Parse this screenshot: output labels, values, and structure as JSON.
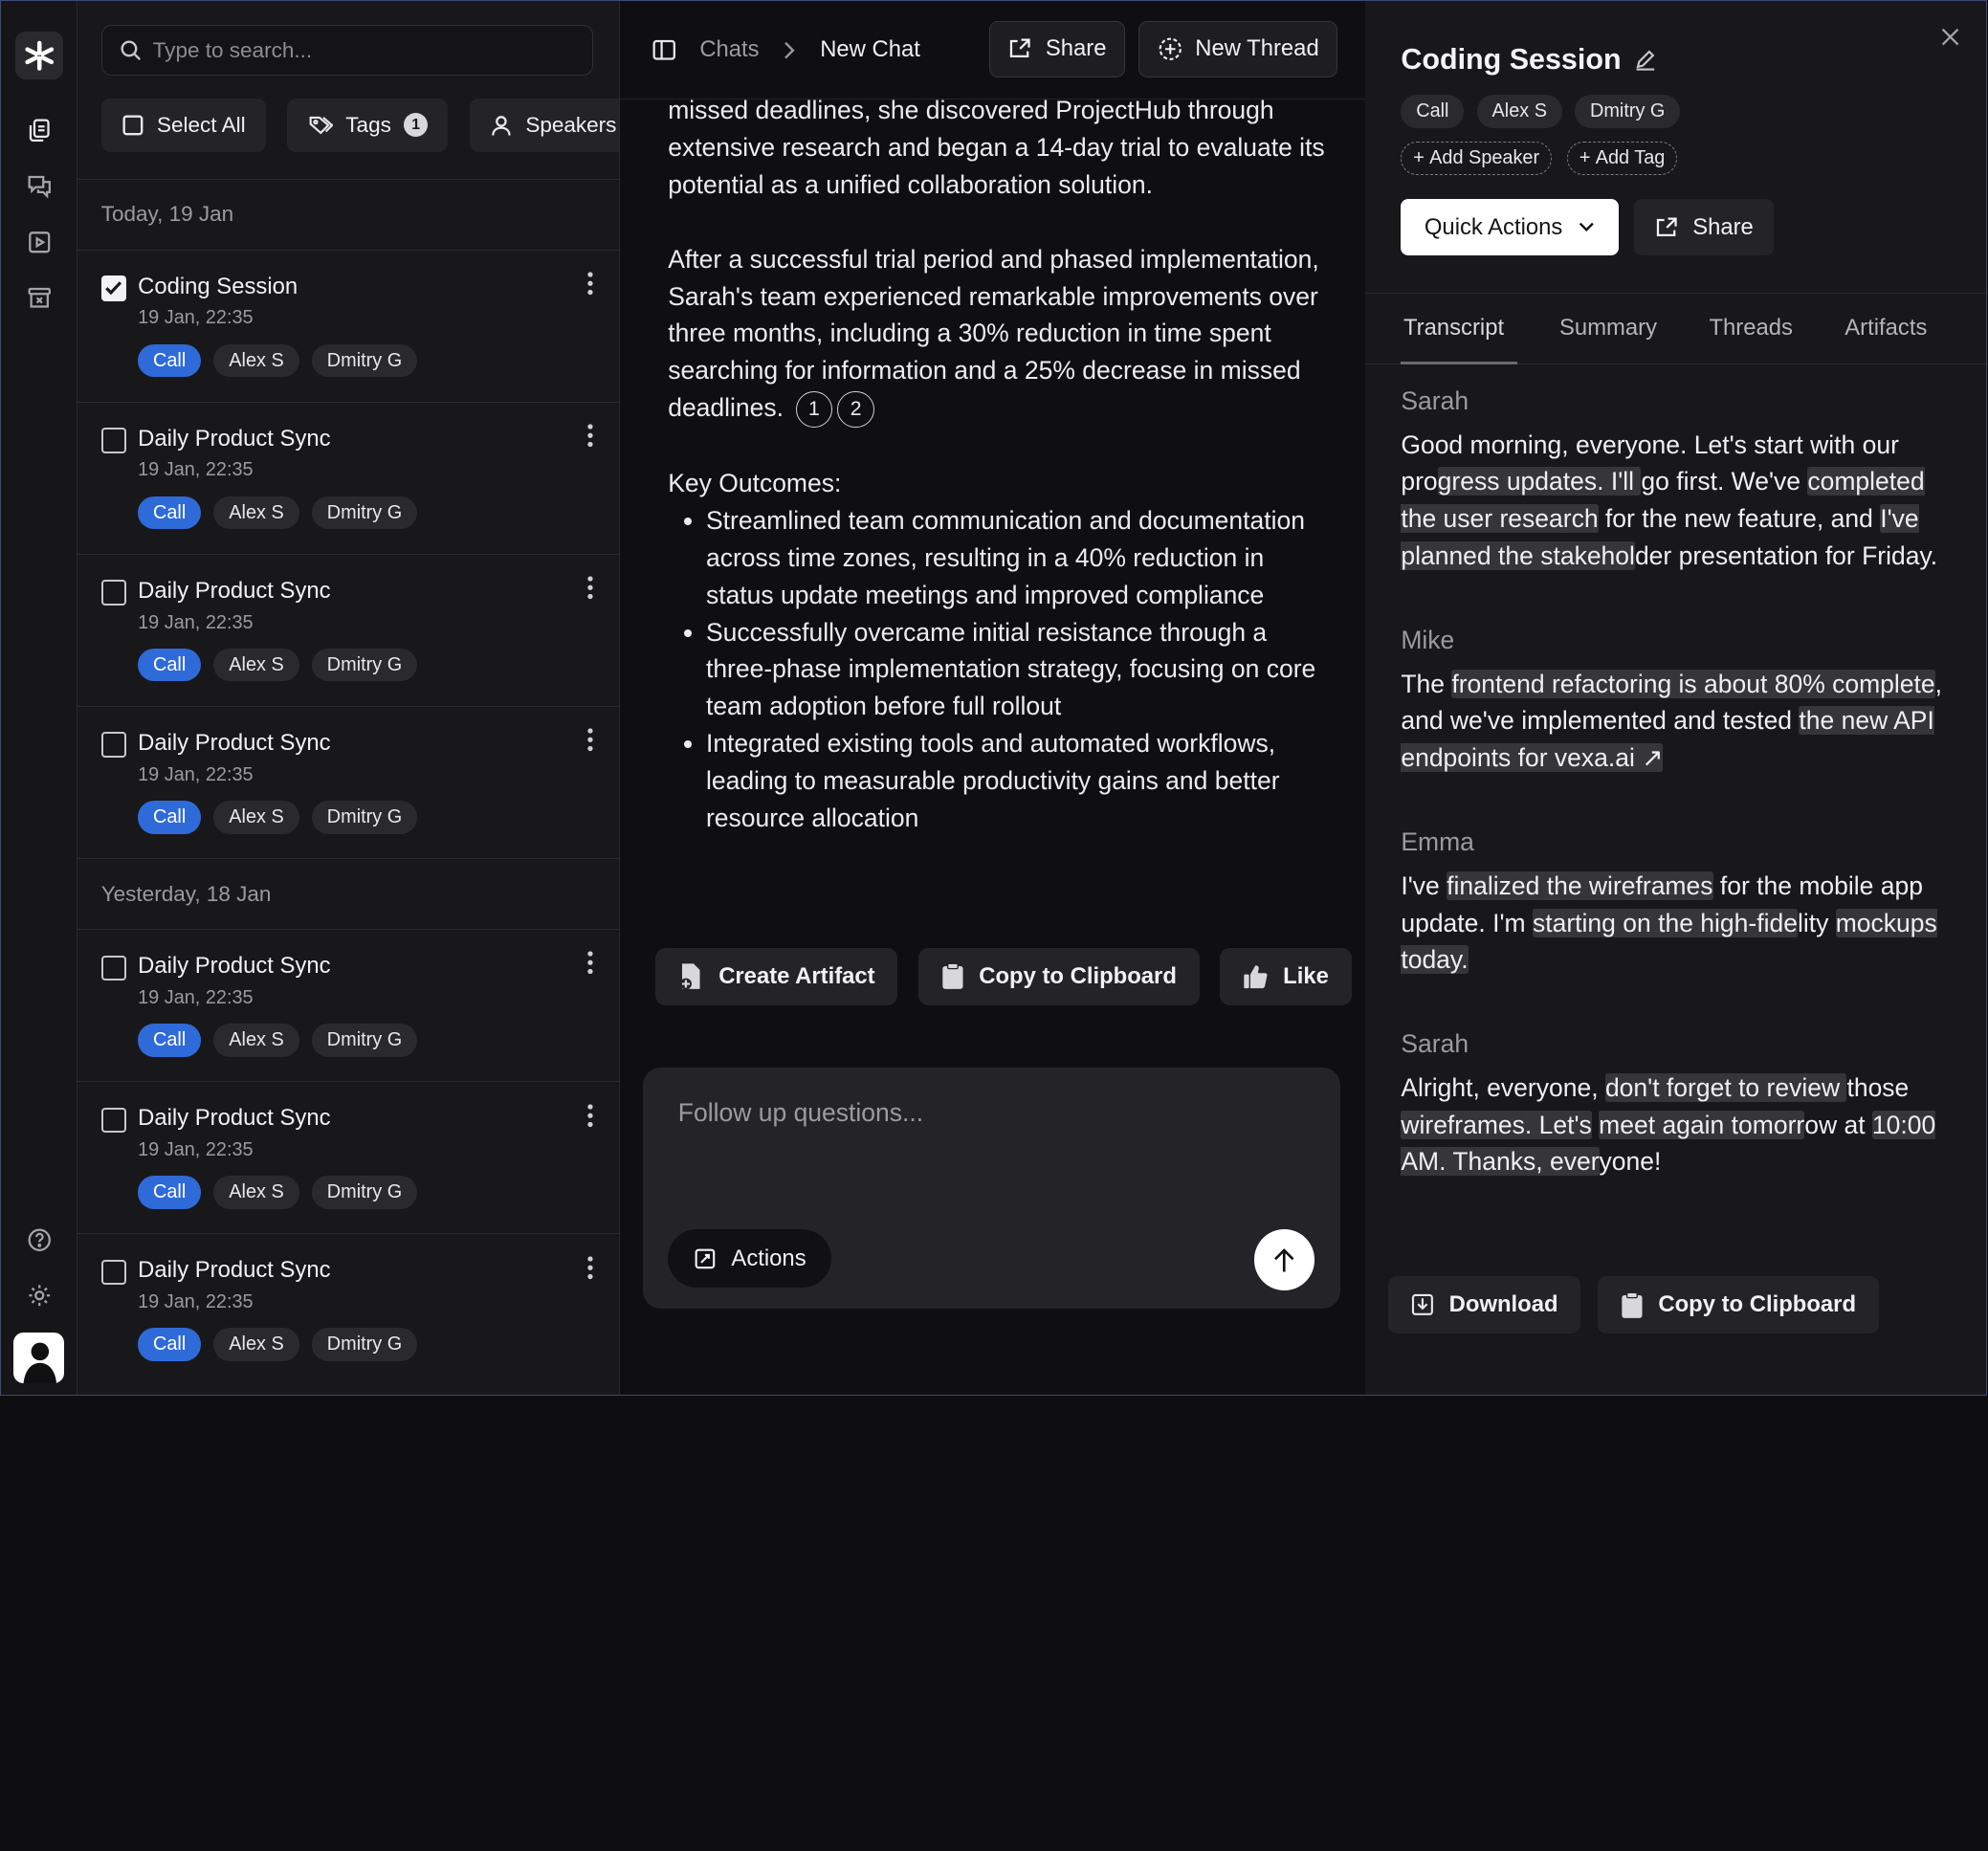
{
  "search": {
    "placeholder": "Type to search..."
  },
  "toolbar": {
    "select_all": "Select All",
    "tags": "Tags",
    "tags_count": "1",
    "speakers": "Speakers"
  },
  "groups": [
    {
      "label": "Today, 19 Jan"
    },
    {
      "label": "Yesterday, 18 Jan"
    }
  ],
  "items": [
    {
      "title": "Coding Session",
      "date": "19 Jan, 22:35",
      "checked": true,
      "tags": [
        "Call",
        "Alex S",
        "Dmitry G"
      ]
    },
    {
      "title": "Daily Product Sync",
      "date": "19 Jan, 22:35",
      "checked": false,
      "tags": [
        "Call",
        "Alex S",
        "Dmitry G"
      ]
    },
    {
      "title": "Daily Product Sync",
      "date": "19 Jan, 22:35",
      "checked": false,
      "tags": [
        "Call",
        "Alex S",
        "Dmitry G"
      ]
    },
    {
      "title": "Daily Product Sync",
      "date": "19 Jan, 22:35",
      "checked": false,
      "tags": [
        "Call",
        "Alex S",
        "Dmitry G"
      ]
    },
    {
      "title": "Daily Product Sync",
      "date": "19 Jan, 22:35",
      "checked": false,
      "tags": [
        "Call",
        "Alex S",
        "Dmitry G"
      ]
    },
    {
      "title": "Daily Product Sync",
      "date": "19 Jan, 22:35",
      "checked": false,
      "tags": [
        "Call",
        "Alex S",
        "Dmitry G"
      ]
    },
    {
      "title": "Daily Product Sync",
      "date": "19 Jan, 22:35",
      "checked": false,
      "tags": [
        "Call",
        "Alex S",
        "Dmitry G"
      ]
    }
  ],
  "chat": {
    "breadcrumb": [
      "Chats",
      "New Chat"
    ],
    "share": "Share",
    "new_thread": "New Thread",
    "p1": "missed deadlines, she discovered ProjectHub through extensive research and began a 14-day trial to evaluate its potential as a unified collaboration solution.",
    "p2": "After a successful trial period and phased implementation, Sarah's team experienced remarkable improvements over three months, including a 30% reduction in time spent searching for information and a 25% decrease in missed deadlines.",
    "citations": [
      "1",
      "2"
    ],
    "outcomes_title": "Key Outcomes:",
    "outcomes": [
      "Streamlined team communication and documentation across time zones, resulting in a 40% reduction in status update meetings and improved compliance",
      "Successfully overcame initial resistance through a three-phase implementation strategy, focusing on core team adoption before full rollout",
      "Integrated existing tools and automated workflows, leading to measurable productivity gains and better resource allocation"
    ],
    "actions": {
      "create": "Create Artifact",
      "copy": "Copy to Clipboard",
      "like": "Like"
    },
    "composer_placeholder": "Follow up questions...",
    "actions_btn": "Actions"
  },
  "panel": {
    "title": "Coding Session",
    "tags": [
      "Call",
      "Alex S",
      "Dmitry G"
    ],
    "add_speaker": "Add Speaker",
    "add_tag": "Add Tag",
    "quick_actions": "Quick Actions",
    "share": "Share",
    "tabs": [
      "Transcript",
      "Summary",
      "Threads",
      "Artifacts"
    ],
    "download": "Download",
    "copy": "Copy to Clipboard"
  },
  "transcript": [
    {
      "speaker": "Sarah",
      "segments": [
        {
          "t": "Good morning, everyone. Let's start with our pro"
        },
        {
          "t": "gress updates. I'll ",
          "h": true
        },
        {
          "t": "go first. We've "
        },
        {
          "t": "completed the user research",
          "h": true
        },
        {
          "t": " for the new feature, and "
        },
        {
          "t": "I've planned the stakehol",
          "h": true
        },
        {
          "t": "der presentation for Friday."
        }
      ]
    },
    {
      "speaker": "Mike",
      "segments": [
        {
          "t": "The "
        },
        {
          "t": "frontend refactoring is about 80% complete",
          "h": true
        },
        {
          "t": ", and we've implemented and tested "
        },
        {
          "t": "the new API endpoints for vexa.ai ↗",
          "h": true
        }
      ]
    },
    {
      "speaker": "Emma",
      "segments": [
        {
          "t": "I've "
        },
        {
          "t": "finalized the wireframes",
          "h": true
        },
        {
          "t": " for the mobile app update. I'm "
        },
        {
          "t": "starting on the high-fide",
          "h": true
        },
        {
          "t": "lity "
        },
        {
          "t": "mockups today.",
          "h": true
        }
      ]
    },
    {
      "speaker": "Sarah",
      "segments": [
        {
          "t": "Alright, everyone, "
        },
        {
          "t": "don't forget to review ",
          "h": true
        },
        {
          "t": "those "
        },
        {
          "t": "wireframes. Let's",
          "h": true
        },
        {
          "t": " "
        },
        {
          "t": "meet again tomorr",
          "h": true
        },
        {
          "t": "ow at "
        },
        {
          "t": "10:00 AM. Thanks, ever",
          "h": true
        },
        {
          "t": "yone!"
        }
      ]
    }
  ]
}
